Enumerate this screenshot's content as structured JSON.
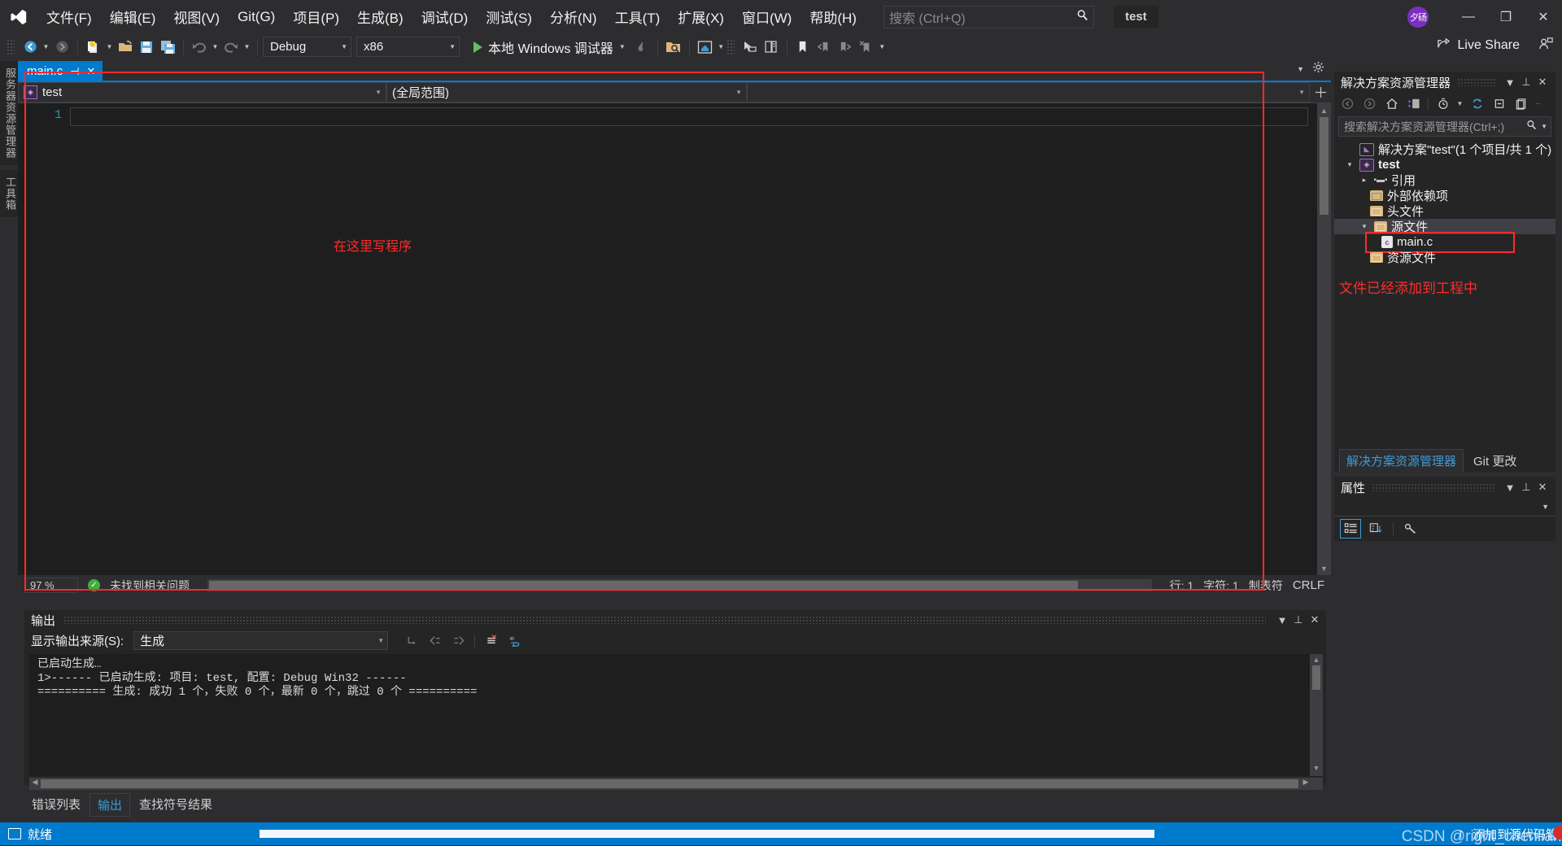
{
  "window": {
    "project_badge": "test",
    "avatar_initials": "夕砀",
    "live_share": "Live Share",
    "minimize": "—",
    "maximize": "❐",
    "close": "✕"
  },
  "menu": {
    "items": [
      {
        "label": "文件(F)",
        "name": "menu-file"
      },
      {
        "label": "编辑(E)",
        "name": "menu-edit"
      },
      {
        "label": "视图(V)",
        "name": "menu-view"
      },
      {
        "label": "Git(G)",
        "name": "menu-git"
      },
      {
        "label": "项目(P)",
        "name": "menu-project"
      },
      {
        "label": "生成(B)",
        "name": "menu-build"
      },
      {
        "label": "调试(D)",
        "name": "menu-debug"
      },
      {
        "label": "测试(S)",
        "name": "menu-test"
      },
      {
        "label": "分析(N)",
        "name": "menu-analyze"
      },
      {
        "label": "工具(T)",
        "name": "menu-tools"
      },
      {
        "label": "扩展(X)",
        "name": "menu-extensions"
      },
      {
        "label": "窗口(W)",
        "name": "menu-window"
      },
      {
        "label": "帮助(H)",
        "name": "menu-help"
      }
    ]
  },
  "search": {
    "placeholder": "搜索 (Ctrl+Q)",
    "icon": "search-icon"
  },
  "toolbar": {
    "configuration": "Debug",
    "platform": "x86",
    "run_label": "本地 Windows 调试器",
    "back_icon": "navigate-back-icon",
    "forward_icon": "navigate-forward-icon",
    "new_icon": "new-file-icon",
    "open_icon": "open-file-icon",
    "save_icon": "save-icon",
    "save_all_icon": "save-all-icon",
    "undo_icon": "undo-icon",
    "redo_icon": "redo-icon"
  },
  "left_rail": {
    "tabs": [
      {
        "label": "服务器资源管理器",
        "name": "server-explorer-tab"
      },
      {
        "label": "工具箱",
        "name": "toolbox-tab"
      }
    ]
  },
  "editor": {
    "tab": {
      "title": "main.c",
      "pin_icon": "pin-icon",
      "close_icon": "close-icon"
    },
    "nav_project": "test",
    "nav_scope": "(全局范围)",
    "line_number": "1",
    "annotation": "在这里写程序",
    "status": {
      "zoom": "97 %",
      "issues": "未找到相关问题",
      "line": "行: 1",
      "column": "字符: 1",
      "tabs": "制表符",
      "eol": "CRLF"
    }
  },
  "solution_explorer": {
    "title": "解决方案资源管理器",
    "search_placeholder": "搜索解决方案资源管理器(Ctrl+;)",
    "toolbar_icons": [
      "back-icon",
      "forward-icon",
      "home-icon",
      "switch-views-icon",
      "pending-changes-icon",
      "refresh-icon",
      "collapse-all-icon",
      "properties-icon"
    ],
    "tree": [
      {
        "label": "解决方案\"test\"(1 个项目/共 1 个)",
        "indent": 0,
        "icon": "solution-icon",
        "twisty": "",
        "name": "tree-node-solution"
      },
      {
        "label": "test",
        "indent": 1,
        "icon": "project-icon",
        "twisty": "▾",
        "bold": true,
        "name": "tree-node-project"
      },
      {
        "label": "引用",
        "indent": 2,
        "icon": "references-icon",
        "twisty": "▸",
        "name": "tree-node-references"
      },
      {
        "label": "外部依赖项",
        "indent": 2,
        "icon": "folder-ext-icon",
        "twisty": "",
        "name": "tree-node-external-deps"
      },
      {
        "label": "头文件",
        "indent": 2,
        "icon": "folder-filter-icon",
        "twisty": "",
        "name": "tree-node-header-files"
      },
      {
        "label": "源文件",
        "indent": 2,
        "icon": "folder-filter-icon",
        "twisty": "▾",
        "selected": true,
        "name": "tree-node-source-files"
      },
      {
        "label": "main.c",
        "indent": 3,
        "icon": "c-file-icon",
        "twisty": "",
        "highlight": true,
        "name": "tree-node-main-c"
      },
      {
        "label": "资源文件",
        "indent": 2,
        "icon": "folder-filter-icon",
        "twisty": "",
        "name": "tree-node-resource-files"
      }
    ],
    "note": "文件已经添加到工程中",
    "dock_tabs": [
      {
        "label": "解决方案资源管理器",
        "active": true,
        "name": "dock-tab-solution-explorer"
      },
      {
        "label": "Git 更改",
        "active": false,
        "name": "dock-tab-git-changes"
      }
    ]
  },
  "properties": {
    "title": "属性",
    "buttons": [
      "categorized-icon",
      "alphabetical-icon",
      "property-pages-icon"
    ]
  },
  "output": {
    "title": "输出",
    "source_label": "显示输出来源(S):",
    "source_value": "生成",
    "toolbar_icons": [
      "jump-to-icon",
      "previous-icon",
      "next-icon",
      "clear-all-icon",
      "word-wrap-icon"
    ],
    "lines": [
      "已启动生成…",
      "1>------ 已启动生成: 项目: test, 配置: Debug Win32 ------",
      "========== 生成: 成功 1 个，失败 0 个，最新 0 个，跳过 0 个 =========="
    ]
  },
  "bottom_tabs": [
    {
      "label": "错误列表",
      "active": false,
      "name": "bottom-tab-error-list"
    },
    {
      "label": "输出",
      "active": true,
      "name": "bottom-tab-output"
    },
    {
      "label": "查找符号结果",
      "active": false,
      "name": "bottom-tab-find-symbol"
    }
  ],
  "statusbar": {
    "ready": "就绪",
    "source_control": "添加到源代码管理",
    "up_arrow": "↑",
    "watermark": "CSDN @right_chenliang"
  },
  "colors": {
    "accent": "#007acc",
    "annotation_red": "#ff2b2b",
    "chrome": "#2d2d30",
    "panel": "#252526",
    "editor_bg": "#1e1e1e"
  }
}
